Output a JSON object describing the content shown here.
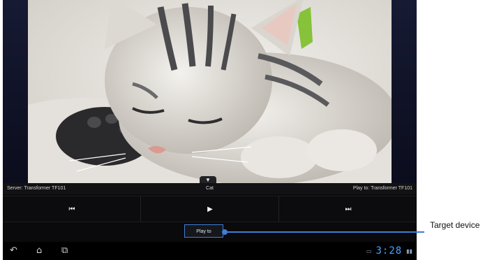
{
  "info_bar": {
    "server": "Server: Transformer TF101",
    "title": "Cat",
    "play_to": "Play to: Transformer TF101"
  },
  "handle": {
    "icon": "chevron-down-icon",
    "glyph": "▼"
  },
  "controls": {
    "previous_glyph": "⏮",
    "play_glyph": "▶",
    "next_glyph": "⏭"
  },
  "play_to_button": {
    "label": "Play to"
  },
  "nav": {
    "back_glyph": "↶",
    "home_glyph": "⌂",
    "recent_glyph": "⧉"
  },
  "status": {
    "clock": "3:28",
    "gallery_icon": "gallery-icon",
    "battery_icon": "battery-icon",
    "gallery_glyph": "▭",
    "battery_glyph": "▮▮"
  },
  "callout": {
    "label": "Target device"
  },
  "colors": {
    "accent": "#3c7fd6",
    "clock": "#4aa3ff"
  }
}
